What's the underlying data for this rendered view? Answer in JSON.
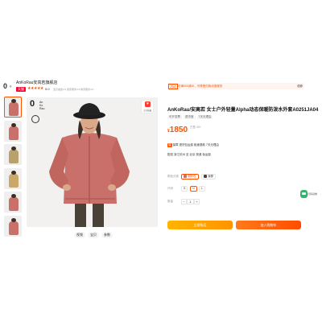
{
  "shop": {
    "logo": "0 ◦",
    "name": "AnKoRau安高若旗舰店",
    "tmall_badge": "天猫",
    "stars": "★★★★★",
    "rating": "5.0",
    "meta": "宝贝描述4.9  卖家服务4.9  物流服务4.9"
  },
  "colors": {
    "accent": "#ff5000",
    "jacket": "#c9706a",
    "buy_btn": "#ffa800",
    "cart_btn": "#ff4d00"
  },
  "thumbnails": [
    {
      "name": "thumb-1",
      "color": "#c9706a"
    },
    {
      "name": "thumb-2",
      "color": "#c9706a"
    },
    {
      "name": "thumb-3",
      "color": "#b8a16a"
    },
    {
      "name": "thumb-4",
      "color": "#c9a86a"
    },
    {
      "name": "thumb-5",
      "color": "#c9706a"
    },
    {
      "name": "thumb-6",
      "color": "#c9706a"
    }
  ],
  "main_image": {
    "brand_logo": "0",
    "brand_small": "An\nKo\nRau",
    "fav_label": "宝贝收藏",
    "tabs": [
      "视频",
      "宝贝",
      "参数"
    ]
  },
  "product": {
    "promo_tag": "活动",
    "promo_text": "可满300减30，可享受付款优惠服务",
    "promo_more": "领券",
    "title": "AnKoRau/安高若 女士户外轻量Alpha动态保暖防泼水外套A0251JA04",
    "subtags": [
      "可开发票",
      "退货宝",
      "7天无理由"
    ],
    "price_currency": "¥",
    "price": "1850",
    "sold": "已售 30+",
    "service_row": "保障  退货包运费  极速退款  7天无理由",
    "delivery_row": "配送  浙江杭州  至  北京  快递 免运费",
    "color_label": "颜色分类",
    "color_selected": "烟粉色",
    "color_other": "深棕",
    "size_label": "尺码",
    "size_options": [
      "S",
      "M",
      "L"
    ],
    "qty_label": "数量",
    "qty_value": "1",
    "buy_label": "立即购买",
    "cart_label": "加入购物车"
  },
  "side_float": {
    "label": "扫码领券"
  }
}
